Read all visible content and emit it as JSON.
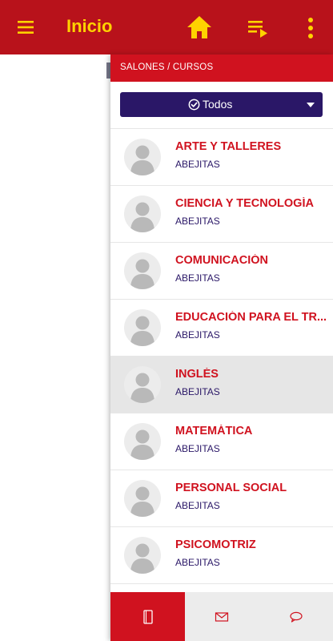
{
  "appbar": {
    "title": "Inicio",
    "menu_icon": "menu-icon",
    "home_icon": "home-icon",
    "playlist_icon": "playlist-play-icon",
    "more_icon": "more-vertical-icon",
    "bar_color": "#b8121b",
    "accent_color": "#ffd200"
  },
  "drawer": {
    "header": "SALONES / CURSOS",
    "filter": {
      "label": "Todos",
      "icon": "check-circle-icon",
      "color": "#2a1767"
    },
    "courses": [
      {
        "name": "ARTE Y TALLERES",
        "group": "ABEJITAS",
        "selected": false
      },
      {
        "name": "CIENCIA Y TECNOLOGÍA",
        "group": "ABEJITAS",
        "selected": false
      },
      {
        "name": "COMUNICACIÓN",
        "group": "ABEJITAS",
        "selected": false
      },
      {
        "name": "EDUCACIÓN PARA EL TR...",
        "group": "ABEJITAS",
        "selected": false
      },
      {
        "name": "INGLÉS",
        "group": "ABEJITAS",
        "selected": true
      },
      {
        "name": "MATEMÁTICA",
        "group": "ABEJITAS",
        "selected": false
      },
      {
        "name": "PERSONAL SOCIAL",
        "group": "ABEJITAS",
        "selected": false
      },
      {
        "name": "PSICOMOTRIZ",
        "group": "ABEJITAS",
        "selected": false
      }
    ],
    "bottom_tabs": [
      {
        "icon": "notebook-icon",
        "active": true
      },
      {
        "icon": "mail-icon",
        "active": false
      },
      {
        "icon": "chat-bubble-icon",
        "active": false
      }
    ],
    "course_color": "#d0121f"
  }
}
